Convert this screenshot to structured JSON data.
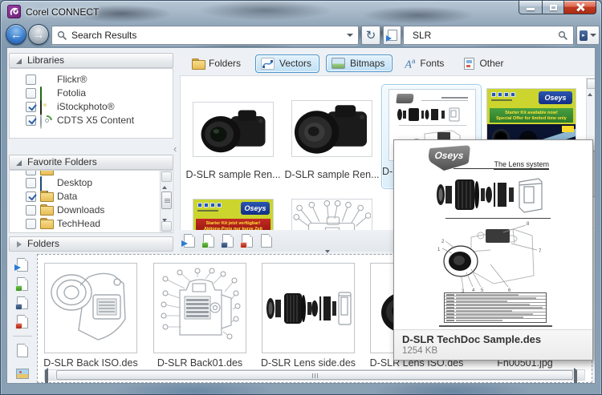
{
  "window": {
    "title": "Corel CONNECT"
  },
  "toolbar": {
    "address_value": "Search Results",
    "search_value": "SLR"
  },
  "brand": "Oseys",
  "sidebar": {
    "libraries": {
      "title": "Libraries",
      "items": [
        {
          "label": "Flickr®",
          "checked": false,
          "icon": "flickr-icon"
        },
        {
          "label": "Fotolia",
          "checked": false,
          "icon": "fotolia-icon"
        },
        {
          "label": "iStockphoto®",
          "checked": true,
          "icon": "istockphoto-icon"
        },
        {
          "label": "CDTS X5 Content",
          "checked": true,
          "icon": "disc-icon"
        }
      ]
    },
    "favorites": {
      "title": "Favorite Folders",
      "items": [
        {
          "label": "Desktop",
          "checked": false,
          "icon": "desktop-icon"
        },
        {
          "label": "Data",
          "checked": true,
          "icon": "folder-icon"
        },
        {
          "label": "Downloads",
          "checked": false,
          "icon": "folder-icon"
        },
        {
          "label": "TechHead",
          "checked": false,
          "icon": "folder-icon"
        }
      ]
    },
    "folders": {
      "title": "Folders"
    }
  },
  "filters": {
    "items": [
      {
        "label": "Folders",
        "active": false,
        "icon": "folder-icon"
      },
      {
        "label": "Vectors",
        "active": true,
        "icon": "vector-curve-icon"
      },
      {
        "label": "Bitmaps",
        "active": true,
        "icon": "image-icon"
      },
      {
        "label": "Fonts",
        "active": false,
        "icon": "font-a-icon"
      },
      {
        "label": "Other",
        "active": false,
        "icon": "document-icon"
      }
    ]
  },
  "results": {
    "items": [
      {
        "label": "D-SLR sample Ren...",
        "selected": false
      },
      {
        "label": "D-SLR sample Ren...",
        "selected": false
      },
      {
        "label": "D-SLR TechDoc Sample.des",
        "selected": true
      },
      {
        "label": "",
        "selected": false
      }
    ],
    "ad_en": {
      "line1": "Starter Kit available now!",
      "line2": "Special Offer for limited time only"
    },
    "ad_de": {
      "line1": "Starter Kit jetzt verfügbar!",
      "line2": "Aktions-Preis nur kurze Zeit"
    }
  },
  "tray": {
    "items": [
      {
        "label": "D-SLR Back ISO.des"
      },
      {
        "label": "D-SLR Back01.des"
      },
      {
        "label": "D-SLR Lens side.des"
      },
      {
        "label": "D-SLR Lens ISO.des"
      },
      {
        "label": "Fn00501.jpg"
      }
    ]
  },
  "popup": {
    "heading": "The Lens system",
    "filename": "D-SLR TechDoc Sample.des",
    "filesize": "1254 KB"
  },
  "icons": {
    "minimize": "bar",
    "maximize": "square",
    "close": "x",
    "back": "←",
    "forward": "→",
    "search": "magnifier",
    "refresh": "↻",
    "expander_open": "◢",
    "expander_closed": "▷",
    "tray_collapse": "▽"
  },
  "colors": {
    "close_red": "#c03a20",
    "brand_purple": "#7d3189",
    "selection_blue": "#9ecbe8",
    "filter_active_border": "#4d94c9",
    "accent_blue": "#2e7ad4",
    "ad_yellow": "#cbd52e"
  }
}
